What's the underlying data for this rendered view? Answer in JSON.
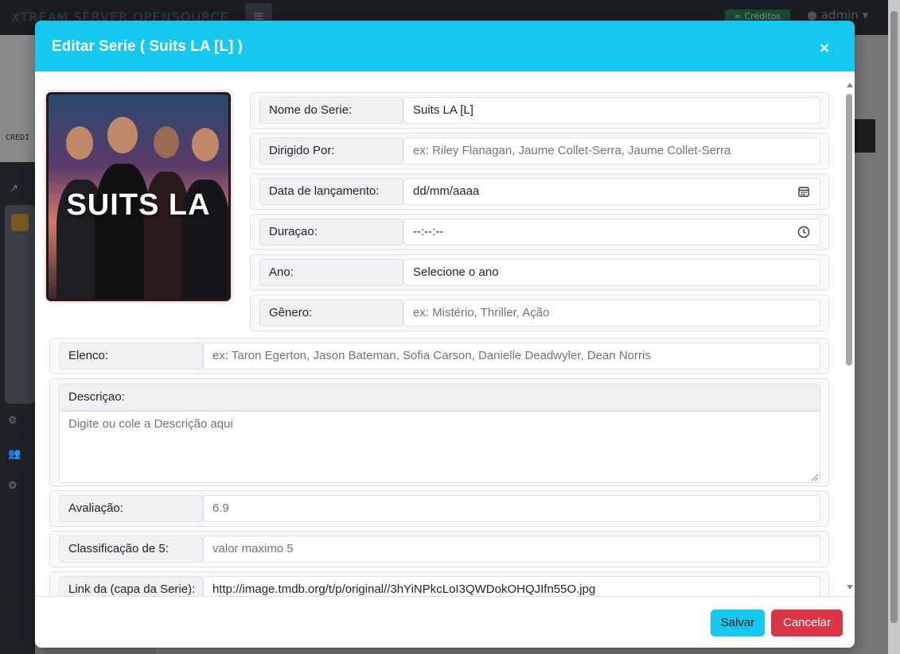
{
  "background": {
    "brand": "XTREAM SERVER OPENSOURCE",
    "credits_label": "Créditos",
    "user_name": "admin",
    "sidebar_card_text": "CREDI"
  },
  "modal": {
    "title": "Editar Serie ( Suits LA [L] )",
    "close_label": "×",
    "poster": {
      "title_text": "SUITS LA"
    },
    "fields": {
      "nome": {
        "label": "Nome do Serie:",
        "value": "Suits LA [L]"
      },
      "dirigido": {
        "label": "Dirigido Por:",
        "placeholder": "ex: Riley Flanagan, Jaume Collet-Serra, Jaume Collet-Serra"
      },
      "data": {
        "label": "Data de lançamento:",
        "value": "dd/mm/aaaa"
      },
      "duracao": {
        "label": "Duraçao:",
        "value": "--:--:--"
      },
      "ano": {
        "label": "Ano:",
        "value": "Selecione o ano"
      },
      "genero": {
        "label": "Gênero:",
        "placeholder": "ex: Mistério, Thriller, Ação"
      },
      "elenco": {
        "label": "Elenco:",
        "placeholder": "ex: Taron Egerton, Jason Bateman, Sofia Carson, Danielle Deadwyler, Dean Norris"
      },
      "descricao": {
        "label": "Descriçao:",
        "placeholder": "Digite ou cole a Descrição aqui"
      },
      "avaliacao": {
        "label": "Avaliação:",
        "value": "6.9"
      },
      "classificacao": {
        "label": "Classificação de 5:",
        "placeholder": "valor maximo 5"
      },
      "link_capa": {
        "label": "Link da (capa da Serie):",
        "value": "http://image.tmdb.org/t/p/original//3hYiNPkcLoI3QWDokOHQJIfn55O.jpg"
      }
    },
    "buttons": {
      "save": "Salvar",
      "cancel": "Cancelar"
    }
  },
  "colors": {
    "header": "#15c8ef",
    "save": "#15c8ef",
    "cancel": "#dc3545"
  }
}
